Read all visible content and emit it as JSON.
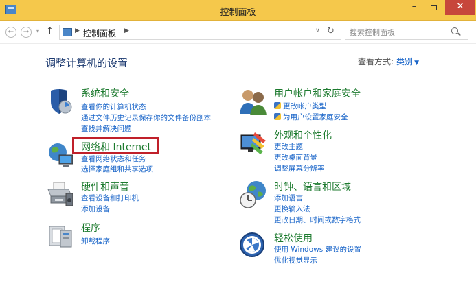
{
  "window": {
    "title": "控制面板",
    "minimize_label": "–",
    "close_label": "✕"
  },
  "navbar": {
    "back_icon": "back-arrow-icon",
    "forward_icon": "forward-arrow-icon",
    "up_icon": "up-arrow-icon",
    "breadcrumb": [
      "控制面板"
    ],
    "search_placeholder": "搜索控制面板"
  },
  "main": {
    "page_title": "调整计算机的设置",
    "view_by_label": "查看方式:",
    "view_by_value": "类别"
  },
  "categories": [
    {
      "title": "系统和安全",
      "icon": "shield-icon",
      "links": [
        "查看你的计算机状态",
        "通过文件历史记录保存你的文件备份副本",
        "查找并解决问题"
      ]
    },
    {
      "title": "网络和 Internet",
      "icon": "network-globe-icon",
      "links": [
        "查看网络状态和任务",
        "选择家庭组和共享选项"
      ]
    },
    {
      "title": "硬件和声音",
      "icon": "printer-icon",
      "links": [
        "查看设备和打印机",
        "添加设备"
      ]
    },
    {
      "title": "程序",
      "icon": "programs-icon",
      "links": [
        "卸载程序"
      ]
    },
    {
      "title": "用户帐户和家庭安全",
      "icon": "users-icon",
      "links": [
        "更改帐户类型",
        "为用户设置家庭安全"
      ]
    },
    {
      "title": "外观和个性化",
      "icon": "appearance-icon",
      "links": [
        "更改主题",
        "更改桌面背景",
        "调整屏幕分辨率"
      ]
    },
    {
      "title": "时钟、语言和区域",
      "icon": "clock-globe-icon",
      "links": [
        "添加语言",
        "更换输入法",
        "更改日期、时间或数字格式"
      ]
    },
    {
      "title": "轻松使用",
      "icon": "accessibility-icon",
      "links": [
        "使用 Windows 建议的设置",
        "优化视觉显示"
      ]
    }
  ],
  "colors": {
    "titlebar": "#f5c84b",
    "close_button": "#c7463b",
    "link": "#1b66c9",
    "category_title": "#1c7a2e",
    "highlight": "#c0202a"
  }
}
